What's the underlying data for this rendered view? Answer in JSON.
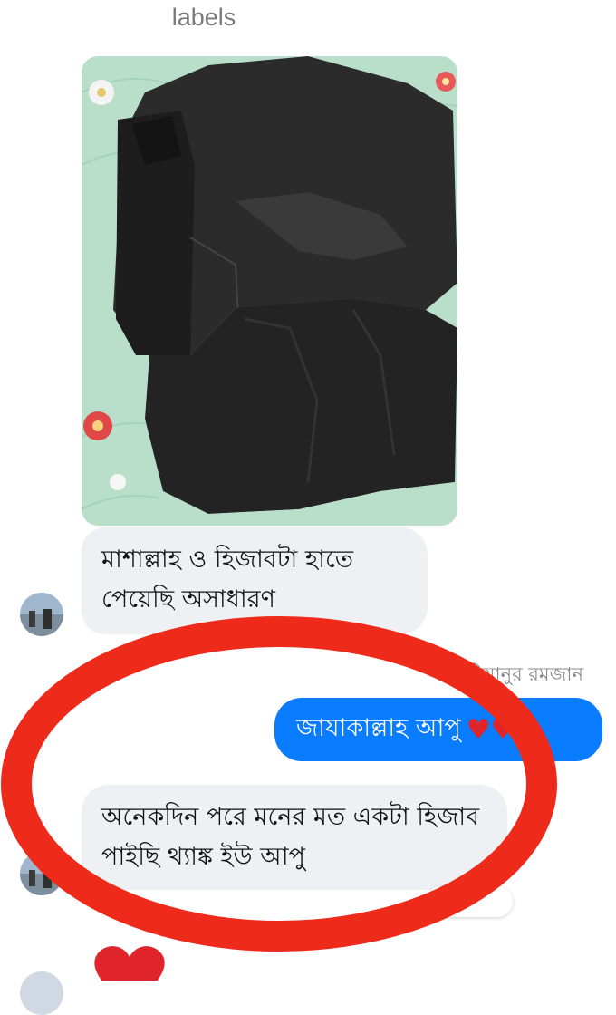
{
  "header": {
    "label": "labels"
  },
  "messages": {
    "received_1": "মাশাল্লাহ ও হিজাবটা হাতে পেয়েছি অসাধারণ",
    "sender_name": "মিযানুর রমজান",
    "sent_1": "জাযাকাল্লাহ আপু",
    "sent_1_emoji": "♥♥",
    "received_2": "অনেকদিন পরে মনের মত একটা হিজাব পাইছি থ্যাঙ্ক ইউ আপু"
  },
  "colors": {
    "sent_bubble": "#0a7cff",
    "received_bubble": "#eef0f3",
    "annotation_circle": "#ee2a1b",
    "heart": "#e0242b"
  },
  "icons": {
    "reaction": "heart-icon",
    "large_reaction": "heart-icon"
  }
}
